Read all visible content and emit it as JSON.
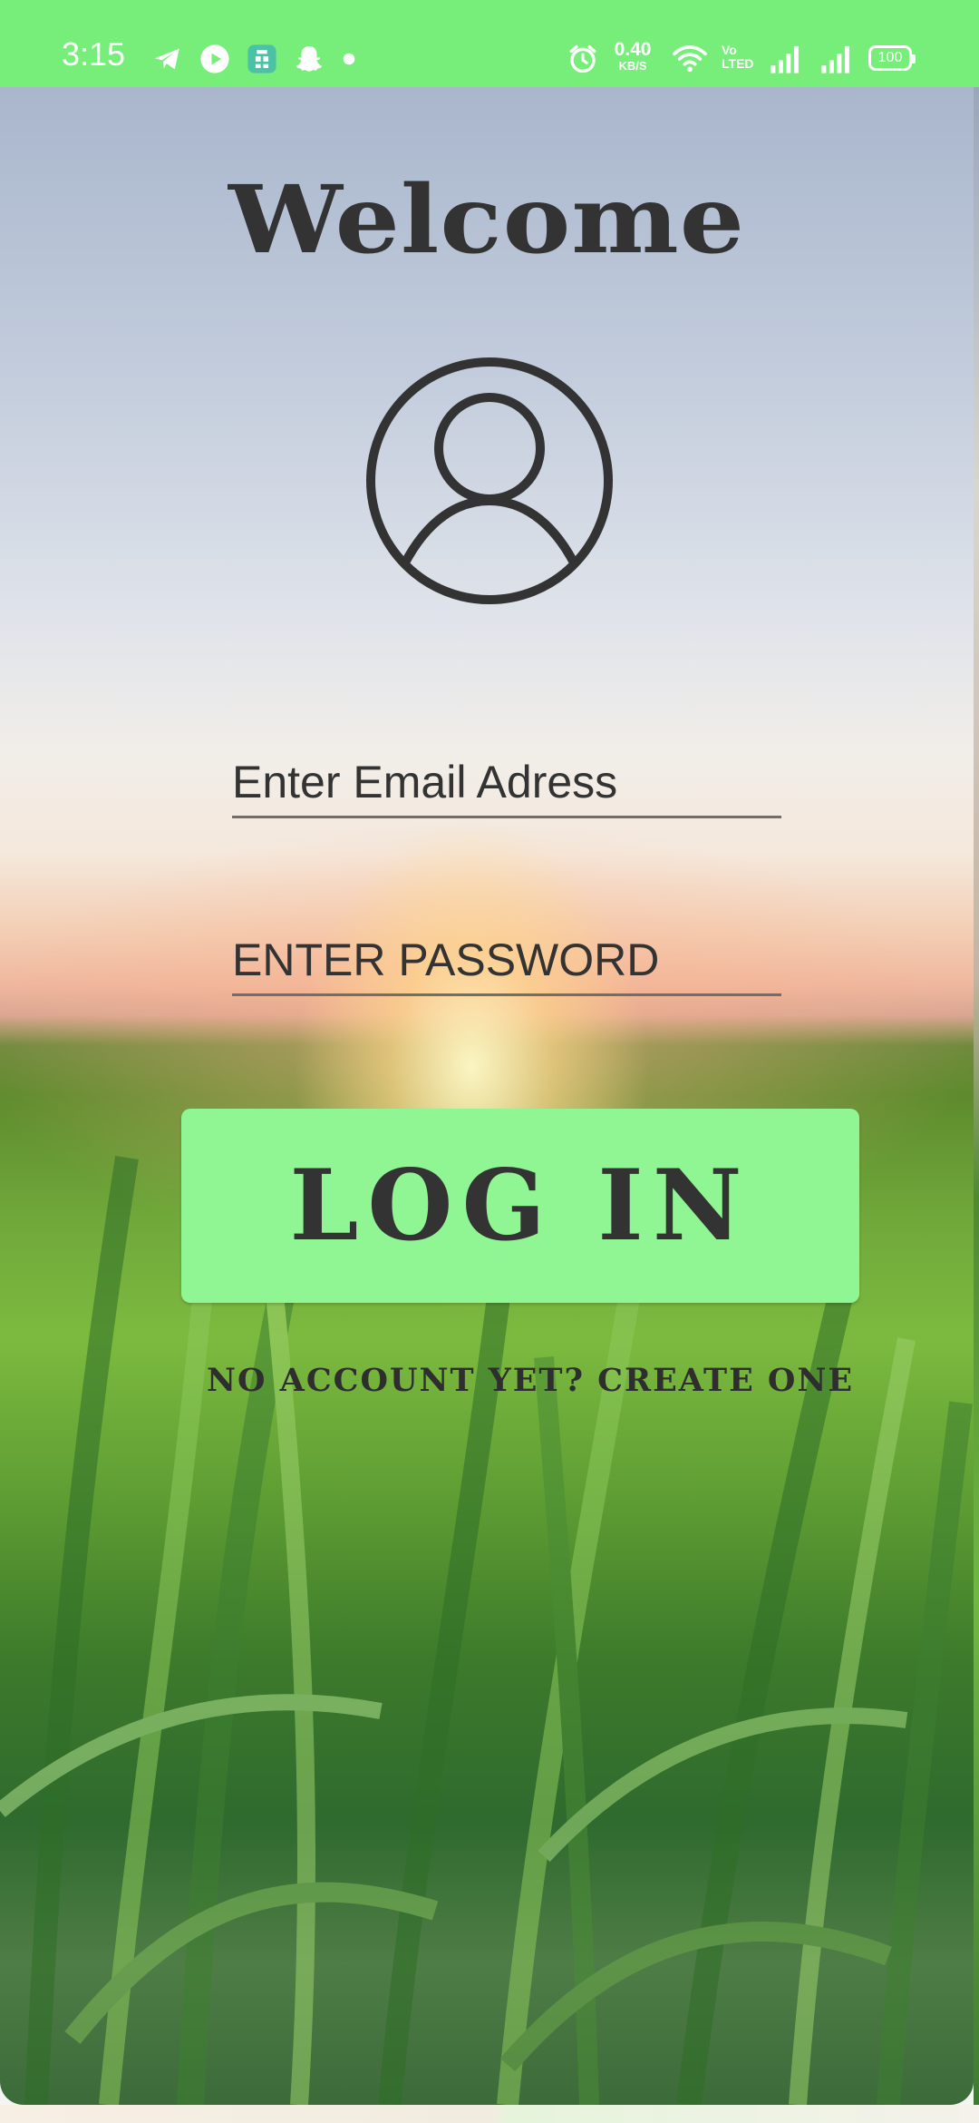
{
  "status_bar": {
    "time": "3:15",
    "net_speed_value": "0.40",
    "net_speed_unit": "KB/S",
    "volte_line1": "Vo",
    "volte_line2": "LTED",
    "battery": "100",
    "left_icons": [
      "telegram-icon",
      "play-icon",
      "app-icon",
      "snapchat-icon",
      "dot-icon"
    ],
    "right_icons": [
      "alarm-icon",
      "wifi-icon",
      "signal-icon",
      "signal-icon"
    ],
    "background_color": "#77ee7a"
  },
  "login": {
    "title": "Welcome",
    "avatar_icon": "account-circle-icon",
    "email_placeholder": "Enter Email Adress",
    "password_placeholder": "ENTER PASSWORD",
    "login_button": "LOG IN",
    "signup_link": "NO ACCOUNT YET? CREATE ONE",
    "background_image": "sunset-grass-field"
  },
  "colors": {
    "accent": "#90f593",
    "status_bar": "#77ee7a",
    "text": "#333333"
  }
}
